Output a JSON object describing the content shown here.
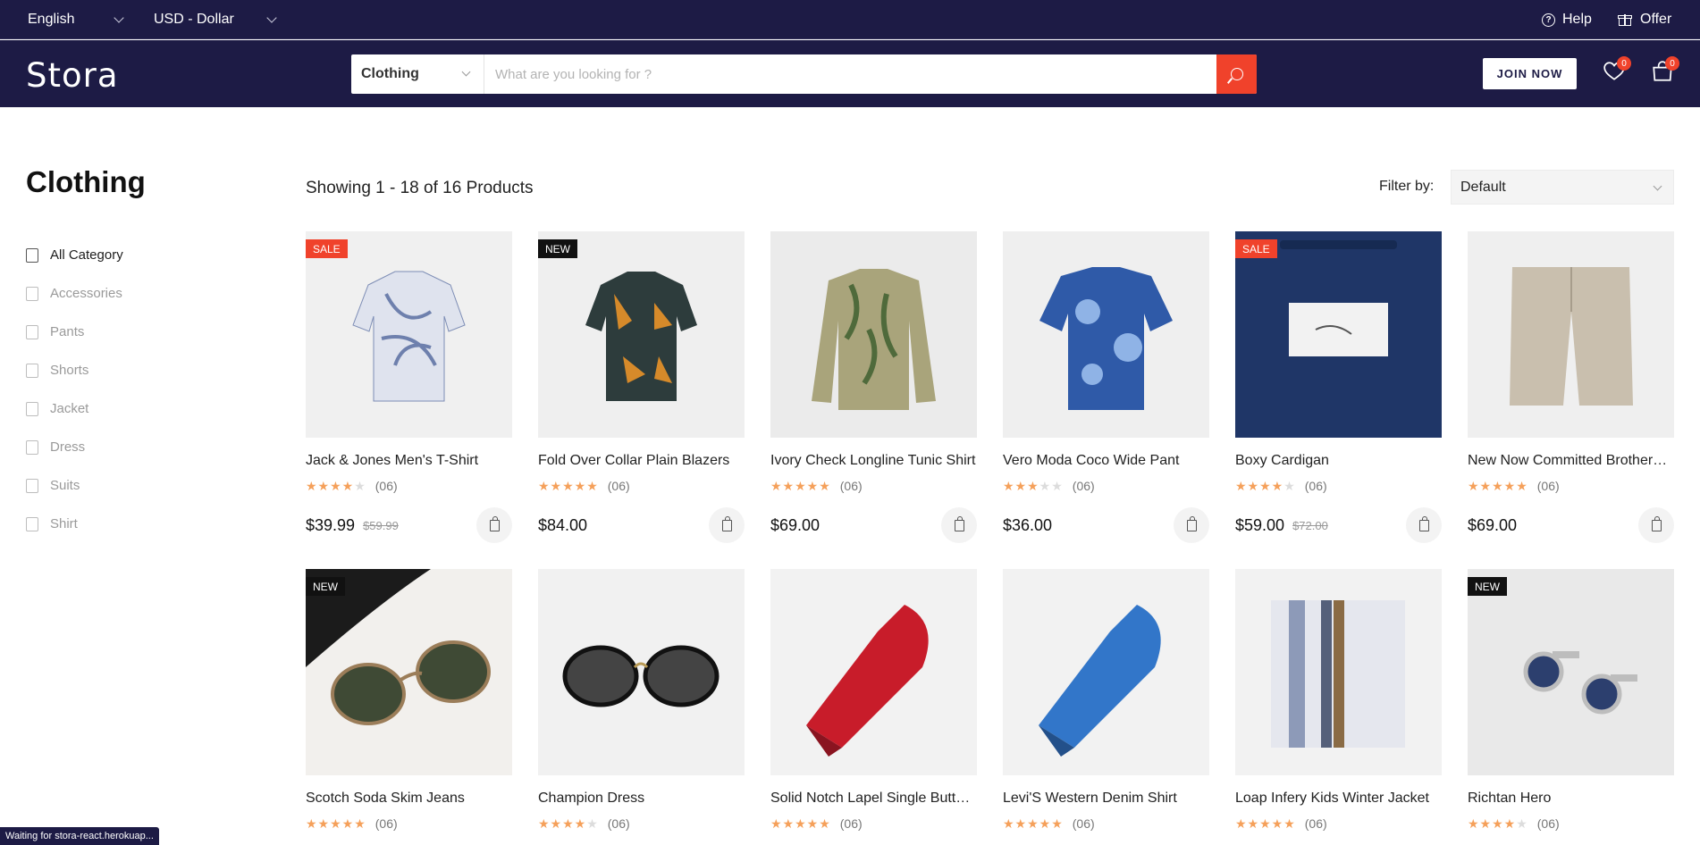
{
  "topbar": {
    "language": "English",
    "currency": "USD - Dollar",
    "help_label": "Help",
    "offer_label": "Offer"
  },
  "header": {
    "logo": "Stora",
    "search_category": "Clothing",
    "search_placeholder": "What are you looking for ?",
    "join_label": "JOIN NOW",
    "wishlist_count": "0",
    "cart_count": "0"
  },
  "sidebar": {
    "title": "Clothing",
    "items": [
      {
        "label": "All Category",
        "icon": "list-icon"
      },
      {
        "label": "Accessories",
        "icon": "accessories-icon"
      },
      {
        "label": "Pants",
        "icon": "pants-icon"
      },
      {
        "label": "Shorts",
        "icon": "shorts-icon"
      },
      {
        "label": "Jacket",
        "icon": "jacket-icon"
      },
      {
        "label": "Dress",
        "icon": "dress-icon"
      },
      {
        "label": "Suits",
        "icon": "suits-icon"
      },
      {
        "label": "Shirt",
        "icon": "shirt-icon"
      }
    ]
  },
  "listing": {
    "showing": "Showing 1 - 18 of 16 Products",
    "filter_label": "Filter by:",
    "filter_value": "Default"
  },
  "products": [
    {
      "name": "Jack & Jones Men's T-Shirt",
      "tag": "SALE",
      "rating": 4,
      "reviews": "(06)",
      "price": "$39.99",
      "old_price": "$59.99"
    },
    {
      "name": "Fold Over Collar Plain Blazers",
      "tag": "NEW",
      "rating": 5,
      "reviews": "(06)",
      "price": "$84.00",
      "old_price": ""
    },
    {
      "name": "Ivory Check Longline Tunic Shirt",
      "tag": "",
      "rating": 5,
      "reviews": "(06)",
      "price": "$69.00",
      "old_price": ""
    },
    {
      "name": "Vero Moda Coco Wide Pant",
      "tag": "",
      "rating": 3,
      "reviews": "(06)",
      "price": "$36.00",
      "old_price": ""
    },
    {
      "name": "Boxy Cardigan",
      "tag": "SALE",
      "rating": 4,
      "reviews": "(06)",
      "price": "$59.00",
      "old_price": "$72.00"
    },
    {
      "name": "New Now Committed Brothers ...",
      "tag": "",
      "rating": 5,
      "reviews": "(06)",
      "price": "$69.00",
      "old_price": ""
    },
    {
      "name": "Scotch Soda Skim Jeans",
      "tag": "NEW",
      "rating": 5,
      "reviews": "(06)",
      "price": "",
      "old_price": ""
    },
    {
      "name": "Champion Dress",
      "tag": "",
      "rating": 4,
      "reviews": "(06)",
      "price": "",
      "old_price": ""
    },
    {
      "name": "Solid Notch Lapel Single Button...",
      "tag": "",
      "rating": 5,
      "reviews": "(06)",
      "price": "",
      "old_price": ""
    },
    {
      "name": "Levi'S Western Denim Shirt",
      "tag": "",
      "rating": 5,
      "reviews": "(06)",
      "price": "",
      "old_price": ""
    },
    {
      "name": "Loap Infery Kids Winter Jacket",
      "tag": "",
      "rating": 5,
      "reviews": "(06)",
      "price": "",
      "old_price": ""
    },
    {
      "name": "Richtan Hero",
      "tag": "NEW",
      "rating": 4,
      "reviews": "(06)",
      "price": "",
      "old_price": ""
    }
  ],
  "status_bar": "Waiting for stora-react.herokuap...",
  "colors": {
    "navy": "#1d1b45",
    "accent": "#f0422b",
    "star": "#f5a05a"
  }
}
